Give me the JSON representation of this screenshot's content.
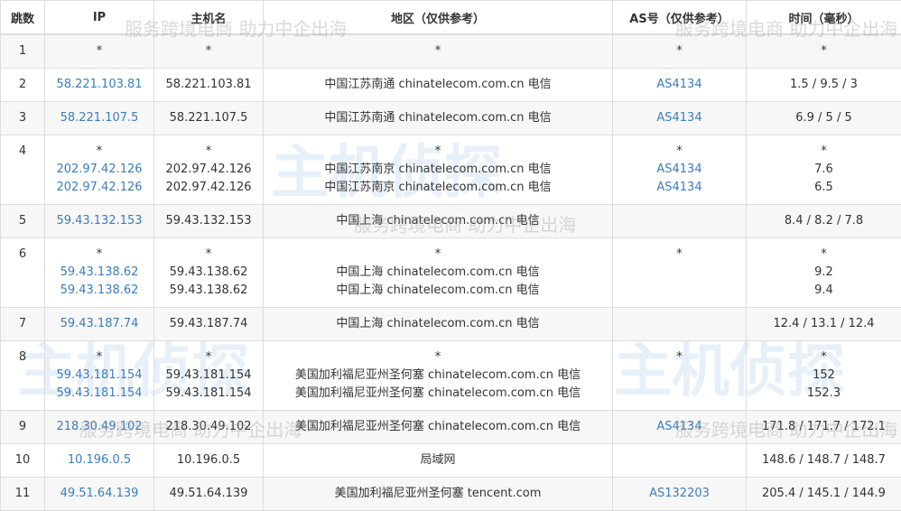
{
  "headers": [
    "跳数",
    "IP",
    "主机名",
    "地区（仅供参考）",
    "AS号（仅供参考）",
    "时间（毫秒）"
  ],
  "watermark": {
    "logo": "主机侦探",
    "slogan": "服务跨境电商 助力中企出海"
  },
  "hops": [
    {
      "hop": "1",
      "lines": [
        {
          "ip": "*",
          "host": "*",
          "region": "*",
          "as": "*",
          "time": "*"
        }
      ]
    },
    {
      "hop": "2",
      "lines": [
        {
          "ip": "58.221.103.81",
          "host": "58.221.103.81",
          "region": "中国江苏南通 chinatelecom.com.cn 电信",
          "as": "AS4134",
          "time": "1.5 / 9.5 / 3"
        }
      ]
    },
    {
      "hop": "3",
      "lines": [
        {
          "ip": "58.221.107.5",
          "host": "58.221.107.5",
          "region": "中国江苏南通 chinatelecom.com.cn 电信",
          "as": "AS4134",
          "time": "6.9 / 5 / 5"
        }
      ]
    },
    {
      "hop": "4",
      "lines": [
        {
          "ip": "*",
          "host": "*",
          "region": "*",
          "as": "*",
          "time": "*"
        },
        {
          "ip": "202.97.42.126",
          "host": "202.97.42.126",
          "region": "中国江苏南京 chinatelecom.com.cn 电信",
          "as": "AS4134",
          "time": "7.6"
        },
        {
          "ip": "202.97.42.126",
          "host": "202.97.42.126",
          "region": "中国江苏南京 chinatelecom.com.cn 电信",
          "as": "AS4134",
          "time": "6.5"
        }
      ]
    },
    {
      "hop": "5",
      "lines": [
        {
          "ip": "59.43.132.153",
          "host": "59.43.132.153",
          "region": "中国上海 chinatelecom.com.cn 电信",
          "as": "",
          "time": "8.4 / 8.2 / 7.8"
        }
      ]
    },
    {
      "hop": "6",
      "lines": [
        {
          "ip": "*",
          "host": "*",
          "region": "*",
          "as": "*",
          "time": "*"
        },
        {
          "ip": "59.43.138.62",
          "host": "59.43.138.62",
          "region": "中国上海 chinatelecom.com.cn 电信",
          "as": "",
          "time": "9.2"
        },
        {
          "ip": "59.43.138.62",
          "host": "59.43.138.62",
          "region": "中国上海 chinatelecom.com.cn 电信",
          "as": "",
          "time": "9.4"
        }
      ]
    },
    {
      "hop": "7",
      "lines": [
        {
          "ip": "59.43.187.74",
          "host": "59.43.187.74",
          "region": "中国上海 chinatelecom.com.cn 电信",
          "as": "",
          "time": "12.4 / 13.1 / 12.4"
        }
      ]
    },
    {
      "hop": "8",
      "lines": [
        {
          "ip": "*",
          "host": "*",
          "region": "*",
          "as": "*",
          "time": "*"
        },
        {
          "ip": "59.43.181.154",
          "host": "59.43.181.154",
          "region": "美国加利福尼亚州圣何塞 chinatelecom.com.cn 电信",
          "as": "",
          "time": "152"
        },
        {
          "ip": "59.43.181.154",
          "host": "59.43.181.154",
          "region": "美国加利福尼亚州圣何塞 chinatelecom.com.cn 电信",
          "as": "",
          "time": "152.3"
        }
      ]
    },
    {
      "hop": "9",
      "lines": [
        {
          "ip": "218.30.49.102",
          "host": "218.30.49.102",
          "region": "美国加利福尼亚州圣何塞 chinatelecom.com.cn 电信",
          "as": "AS4134",
          "time": "171.8 / 171.7 / 172.1"
        }
      ]
    },
    {
      "hop": "10",
      "lines": [
        {
          "ip": "10.196.0.5",
          "host": "10.196.0.5",
          "region": "局域网",
          "as": "",
          "time": "148.6 / 148.7 / 148.7"
        }
      ]
    },
    {
      "hop": "11",
      "lines": [
        {
          "ip": "49.51.64.139",
          "host": "49.51.64.139",
          "region": "美国加利福尼亚州圣何塞 tencent.com",
          "as": "AS132203",
          "time": "205.4 / 145.1 / 144.9"
        }
      ]
    }
  ]
}
